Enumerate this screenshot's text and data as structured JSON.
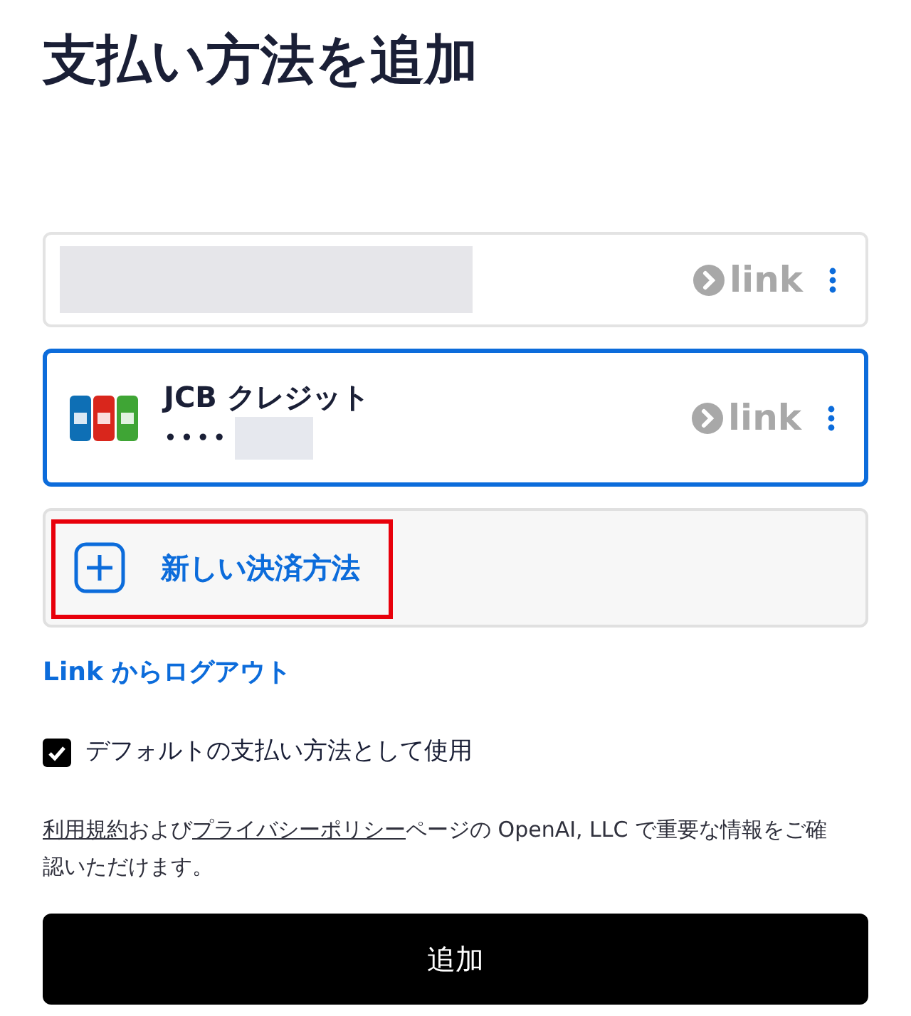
{
  "title": "支払い方法を追加",
  "payment_methods": [
    {
      "kind": "redacted",
      "selected": false,
      "brand": "link"
    },
    {
      "kind": "jcb",
      "name": "JCB クレジット",
      "masked_number": "••••",
      "selected": true,
      "brand": "link"
    }
  ],
  "new_method": {
    "label": "新しい決済方法",
    "highlighted": true
  },
  "logout_link": "Link からログアウト",
  "default_checkbox": {
    "label": "デフォルトの支払い方法として使用",
    "checked": true
  },
  "terms": [
    {
      "kind": "link",
      "text": "利用規約"
    },
    {
      "kind": "text",
      "text": "および"
    },
    {
      "kind": "link",
      "text": "プライバシーポリシー"
    },
    {
      "kind": "text",
      "text": "ページの OpenAI, LLC で重要な情報をご確認いただけます。"
    }
  ],
  "submit_button": "追加"
}
